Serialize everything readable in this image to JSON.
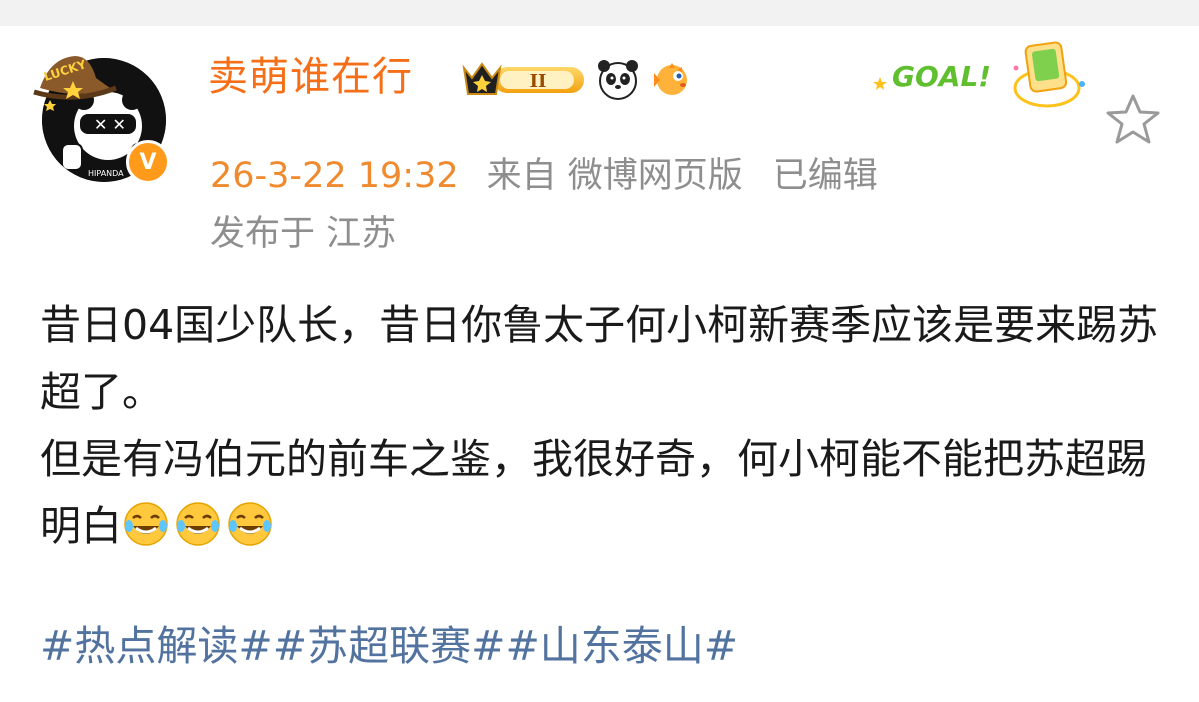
{
  "user": {
    "name": "卖萌谁在行",
    "avatar_label": "LUCKY",
    "badge_level": "II",
    "verified": "V"
  },
  "meta": {
    "time": "26-3-22 19:32",
    "source": "来自 微博网页版",
    "edited": "已编辑",
    "location": "发布于 江苏"
  },
  "sticker": {
    "text": "GOAL!"
  },
  "post": {
    "line1": "昔日04国少队长，昔日你鲁太子何小柯新赛季应该是要来踢苏超了。",
    "line2": "但是有冯伯元的前车之鉴，我很好奇，何小柯能不能把苏超踢明白"
  },
  "hashtags": [
    "#热点解读#",
    "#苏超联赛#",
    "#山东泰山#"
  ],
  "icons": {
    "star": "star-outline-icon",
    "emoji": "laugh-cry-emoji-icon",
    "panda": "panda-icon",
    "fish": "pufferfish-icon"
  },
  "colors": {
    "username": "#f56f18",
    "time": "#ef8a2e",
    "meta": "#8e8e8e",
    "hashtag": "#52739f",
    "text": "#1a1a1a"
  }
}
